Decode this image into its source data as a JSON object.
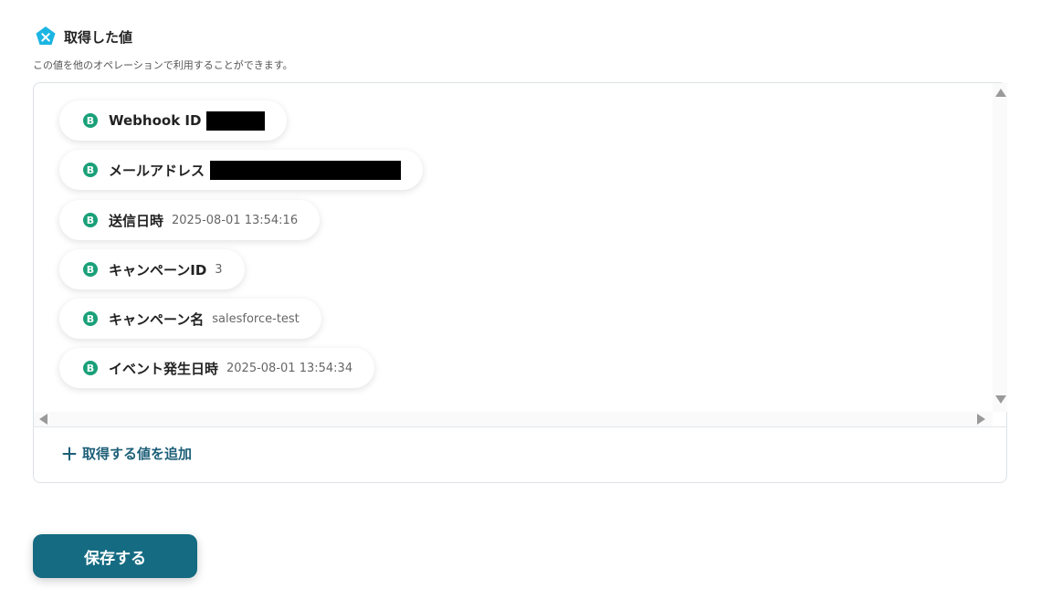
{
  "section": {
    "title": "取得した値",
    "description": "この値を他のオペレーションで利用することができます。"
  },
  "values": [
    {
      "label": "Webhook ID",
      "value": "",
      "redacted": true
    },
    {
      "label": "メールアドレス",
      "value": "",
      "redacted": true
    },
    {
      "label": "送信日時",
      "value": "2025-08-01 13:54:16",
      "redacted": false
    },
    {
      "label": "キャンペーンID",
      "value": "3",
      "redacted": false
    },
    {
      "label": "キャンペーン名",
      "value": "salesforce-test",
      "redacted": false
    },
    {
      "label": "イベント発生日時",
      "value": "2025-08-01 13:54:34",
      "redacted": false
    }
  ],
  "add_value_label": "取得する値を追加",
  "save_button_label": "保存する",
  "icons": {
    "section": "x-pentagon-icon",
    "value": "b-circle-icon",
    "add": "plus-icon"
  },
  "colors": {
    "section_icon": "#1bb5e3",
    "value_icon": "#1aa079",
    "accent": "#146b82",
    "link": "#1d5f78"
  }
}
